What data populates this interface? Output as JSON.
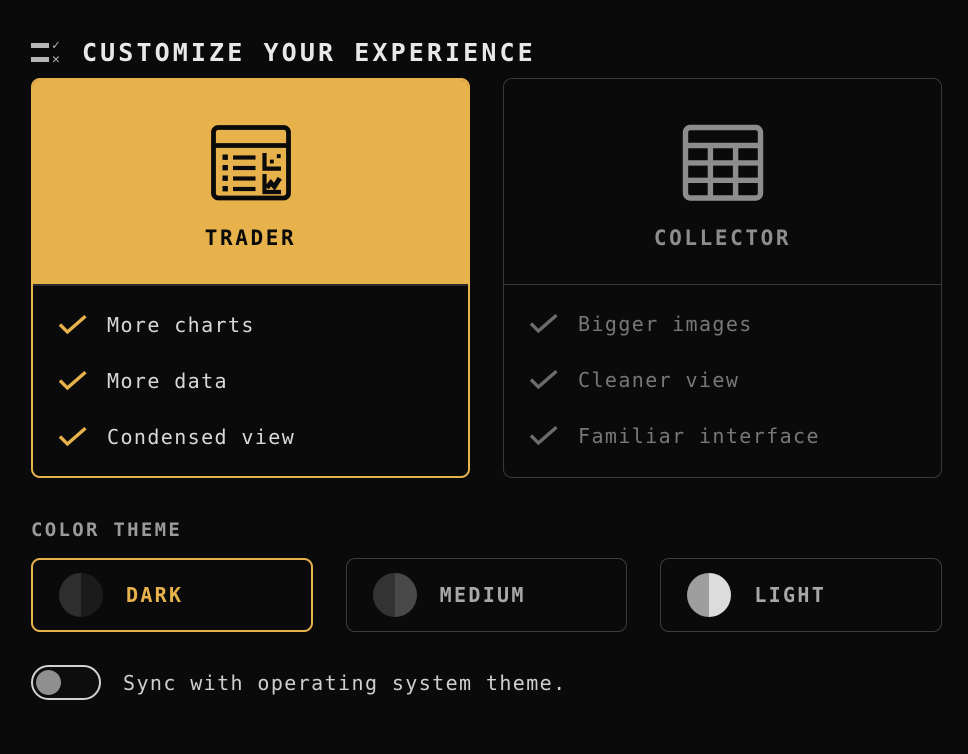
{
  "header": {
    "title": "CUSTOMIZE YOUR EXPERIENCE",
    "icon": "customize-sliders-icon"
  },
  "personas": [
    {
      "id": "trader",
      "title": "TRADER",
      "icon": "chart-list-window-icon",
      "selected": true,
      "features": [
        {
          "label": "More charts",
          "icon": "check-icon"
        },
        {
          "label": "More data",
          "icon": "check-icon"
        },
        {
          "label": "Condensed view",
          "icon": "check-icon"
        }
      ]
    },
    {
      "id": "collector",
      "title": "COLLECTOR",
      "icon": "grid-table-icon",
      "selected": false,
      "features": [
        {
          "label": "Bigger images",
          "icon": "check-icon"
        },
        {
          "label": "Cleaner view",
          "icon": "check-icon"
        },
        {
          "label": "Familiar interface",
          "icon": "check-icon"
        }
      ]
    }
  ],
  "color_theme": {
    "section_label": "COLOR THEME",
    "options": [
      {
        "id": "dark",
        "label": "DARK",
        "selected": true,
        "swatch_left": "#2e2e2e",
        "swatch_right": "#1b1b1b"
      },
      {
        "id": "medium",
        "label": "MEDIUM",
        "selected": false,
        "swatch_left": "#333333",
        "swatch_right": "#494949"
      },
      {
        "id": "light",
        "label": "LIGHT",
        "selected": false,
        "swatch_left": "#9e9e9e",
        "swatch_right": "#dcdcdc"
      }
    ]
  },
  "sync": {
    "label": "Sync with operating system theme.",
    "enabled": false
  },
  "colors": {
    "accent": "#e7b24c",
    "background": "#0a0a0a",
    "text": "#d8d8d8",
    "muted": "#777777",
    "border": "#3a3a3a"
  }
}
